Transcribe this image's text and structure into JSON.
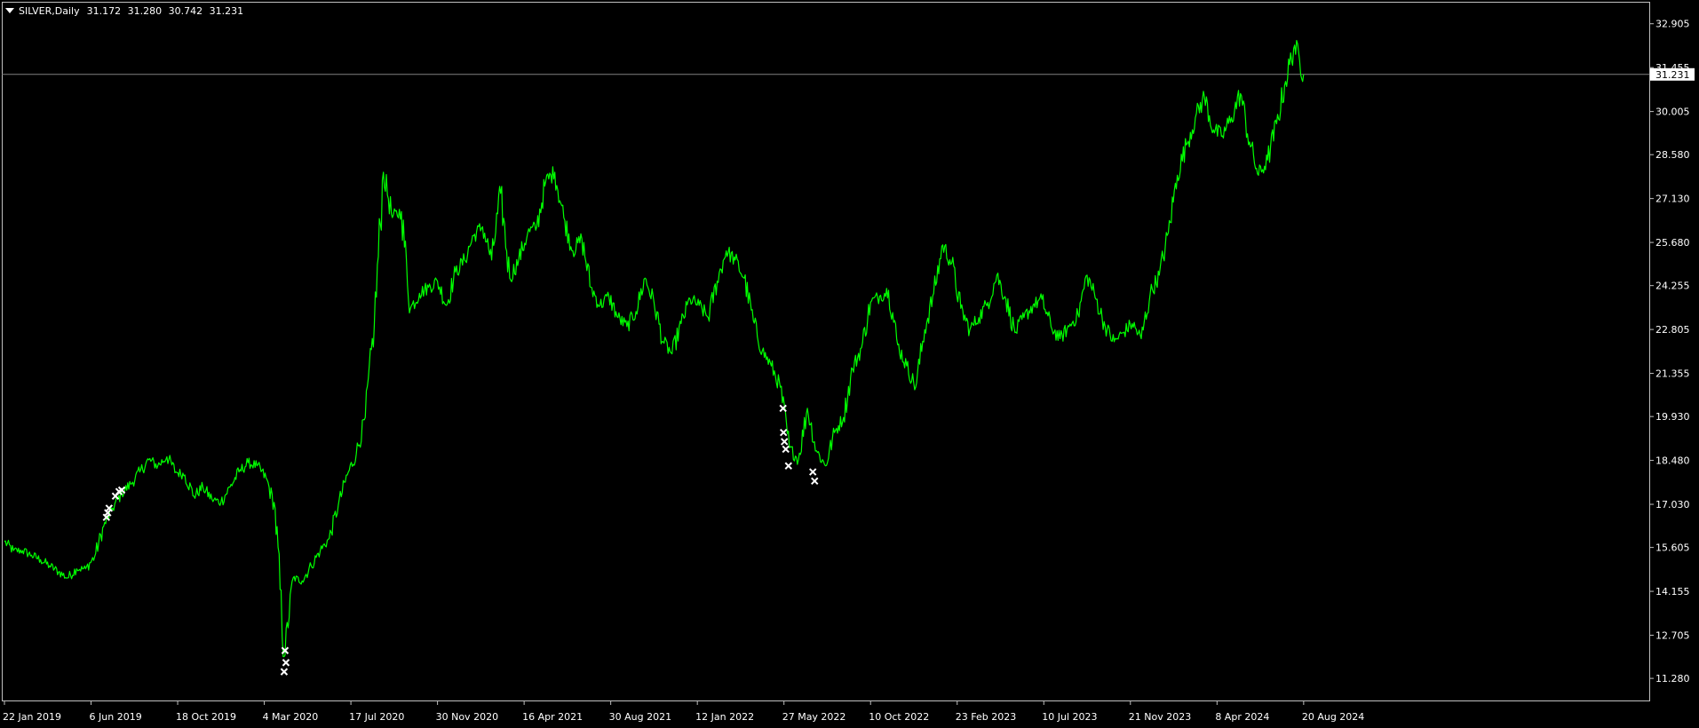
{
  "header": {
    "symbol": "SILVER,Daily",
    "open": "31.172",
    "high": "31.280",
    "low": "30.742",
    "close": "31.231"
  },
  "colors": {
    "background": "#000000",
    "series": "#00ff00",
    "axis": "#c0c0c0",
    "text": "#ffffff",
    "marker": "#ffffff",
    "price_line": "#808080"
  },
  "chart_data": {
    "type": "line",
    "ylim": [
      10.55,
      33.63
    ],
    "x_index_range": [
      0,
      145
    ],
    "yticks": [
      32.905,
      31.455,
      30.005,
      28.58,
      27.13,
      25.68,
      24.255,
      22.805,
      21.355,
      19.93,
      18.48,
      17.03,
      15.605,
      14.155,
      12.705,
      11.28
    ],
    "ytick_labels": [
      "32.905",
      "31.455",
      "30.005",
      "28.580",
      "27.130",
      "25.680",
      "24.255",
      "22.805",
      "21.355",
      "19.930",
      "18.480",
      "17.030",
      "15.605",
      "14.155",
      "12.705",
      "11.280"
    ],
    "current_price": 31.231,
    "current_price_label": "31.231",
    "xticks": [
      {
        "label": "22 Jan 2019",
        "index": 0
      },
      {
        "label": "6 Jun 2019",
        "index": 9.6
      },
      {
        "label": "18 Oct 2019",
        "index": 19.2
      },
      {
        "label": "4 Mar 2020",
        "index": 28.8
      },
      {
        "label": "17 Jul 2020",
        "index": 38.4
      },
      {
        "label": "30 Nov 2020",
        "index": 48
      },
      {
        "label": "16 Apr 2021",
        "index": 57.6
      },
      {
        "label": "30 Aug 2021",
        "index": 67.2
      },
      {
        "label": "12 Jan 2022",
        "index": 76.8
      },
      {
        "label": "27 May 2022",
        "index": 86.4
      },
      {
        "label": "10 Oct 2022",
        "index": 96
      },
      {
        "label": "23 Feb 2023",
        "index": 105.6
      },
      {
        "label": "10 Jul 2023",
        "index": 115.2
      },
      {
        "label": "21 Nov 2023",
        "index": 124.8
      },
      {
        "label": "8 Apr 2024",
        "index": 134.4
      },
      {
        "label": "20 Aug 2024",
        "index": 144
      }
    ],
    "series": [
      {
        "values": [
          15.8,
          15.5,
          15.5,
          15.35,
          15.2,
          15.0,
          14.8,
          14.6,
          14.9,
          14.9,
          15.3,
          16.3,
          16.9,
          17.4,
          17.7,
          18.1,
          18.5,
          18.3,
          18.6,
          18.1,
          18.0,
          17.3,
          17.6,
          17.2,
          17.1,
          17.6,
          18.1,
          18.4,
          18.3,
          17.9,
          16.9,
          12.0,
          14.6,
          14.5,
          15.0,
          15.5,
          15.9,
          17.0,
          18.0,
          18.7,
          19.9,
          23.0,
          28.0,
          26.5,
          26.7,
          23.5,
          24.0,
          24.2,
          24.4,
          23.6,
          24.7,
          25.1,
          25.9,
          26.2,
          25.1,
          27.3,
          24.5,
          25.1,
          26.0,
          26.2,
          27.7,
          28.0,
          26.5,
          25.4,
          25.8,
          24.2,
          23.6,
          23.9,
          23.2,
          22.9,
          23.4,
          24.5,
          23.7,
          22.4,
          22.0,
          23.0,
          23.8,
          23.6,
          23.2,
          24.4,
          25.4,
          25.1,
          24.5,
          23.1,
          22.1,
          21.6,
          20.9,
          18.9,
          18.5,
          20.2,
          18.8,
          18.3,
          19.4,
          19.9,
          21.5,
          22.2,
          23.7,
          23.9,
          24.1,
          22.3,
          21.6,
          20.9,
          22.8,
          24.0,
          25.6,
          25.0,
          23.5,
          22.8,
          23.2,
          23.7,
          24.6,
          23.8,
          22.7,
          23.2,
          23.6,
          23.8,
          22.9,
          22.5,
          22.9,
          23.3,
          24.6,
          23.8,
          22.9,
          22.4,
          22.7,
          23.0,
          22.5,
          24.0,
          24.6,
          26.0,
          27.9,
          28.9,
          29.8,
          30.5,
          29.4,
          29.2,
          29.8,
          30.6,
          29.0,
          27.9,
          28.4,
          29.6,
          31.0,
          32.2,
          31.231
        ]
      }
    ],
    "markers": [
      {
        "x": 11.3,
        "y": 16.6
      },
      {
        "x": 11.45,
        "y": 16.75
      },
      {
        "x": 11.6,
        "y": 16.9
      },
      {
        "x": 12.3,
        "y": 17.3
      },
      {
        "x": 12.7,
        "y": 17.45
      },
      {
        "x": 13.0,
        "y": 17.5
      },
      {
        "x": 31.1,
        "y": 12.2
      },
      {
        "x": 31.2,
        "y": 11.8
      },
      {
        "x": 31.0,
        "y": 11.5
      },
      {
        "x": 86.3,
        "y": 20.2
      },
      {
        "x": 86.35,
        "y": 19.4
      },
      {
        "x": 86.45,
        "y": 19.1
      },
      {
        "x": 86.6,
        "y": 18.85
      },
      {
        "x": 86.9,
        "y": 18.3
      },
      {
        "x": 89.6,
        "y": 18.1
      },
      {
        "x": 89.8,
        "y": 17.8
      }
    ]
  }
}
